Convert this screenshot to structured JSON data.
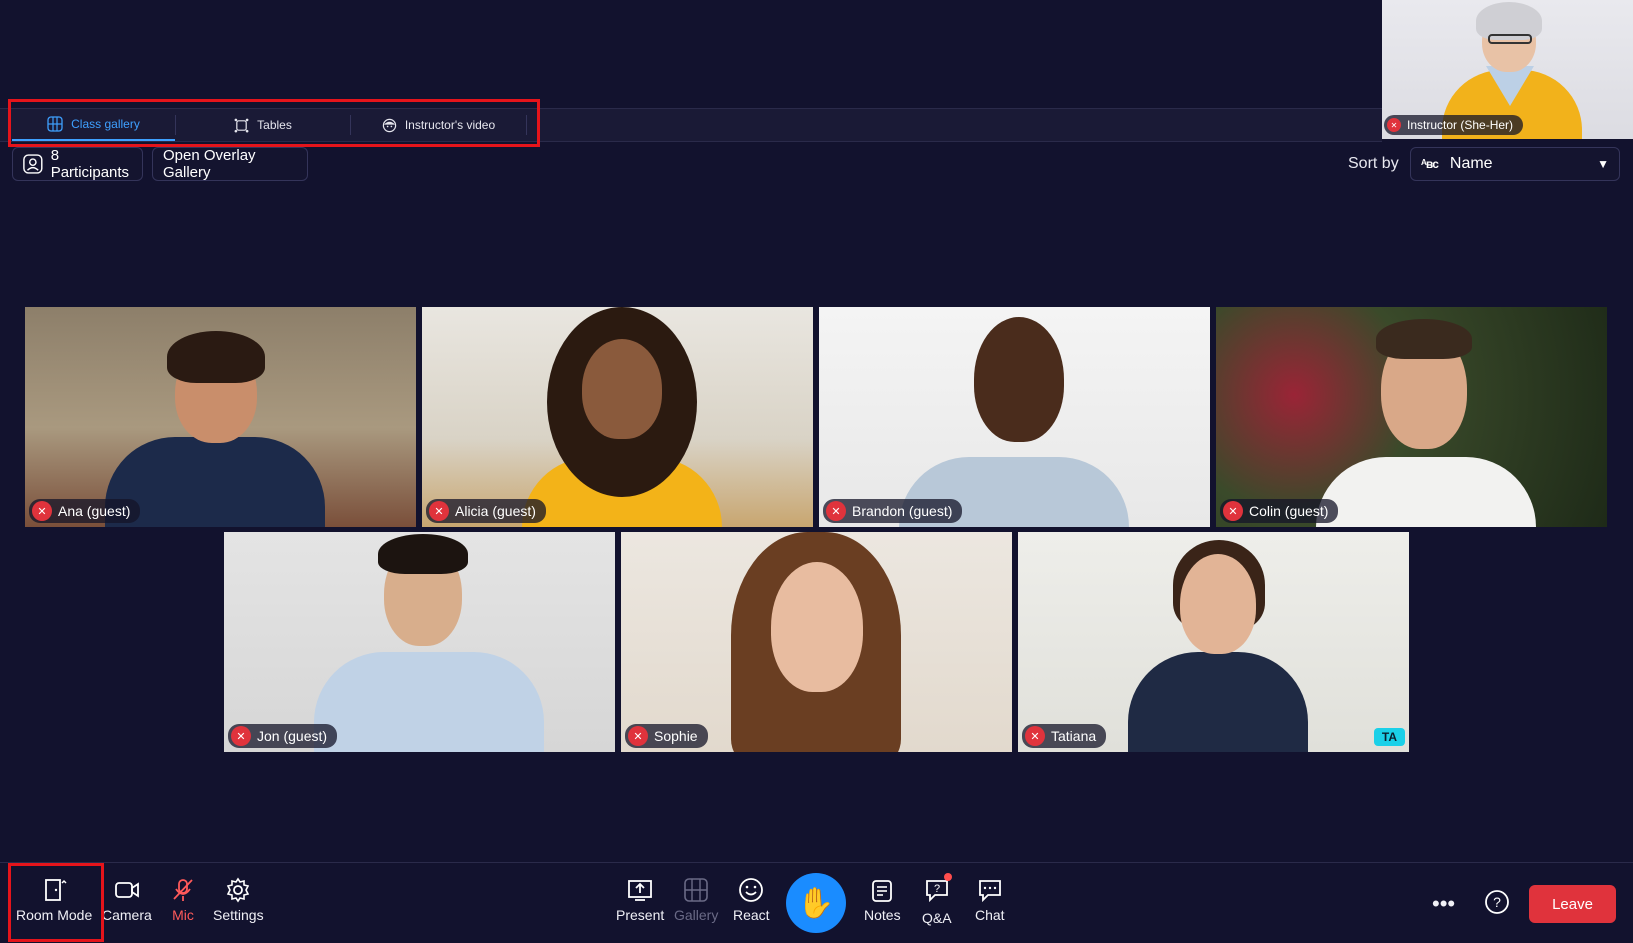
{
  "instructor": {
    "name": "Instructor (She-Her)",
    "mic_state": "muted"
  },
  "tabs": [
    {
      "label": "Class gallery",
      "icon": "grid-globe-icon",
      "active": true
    },
    {
      "label": "Tables",
      "icon": "tables-icon",
      "active": false
    },
    {
      "label": "Instructor's video",
      "icon": "face-icon",
      "active": false
    }
  ],
  "toolbar": {
    "participants_label": "8 Participants",
    "overlay_label": "Open Overlay Gallery",
    "sort_label": "Sort by",
    "sort_value": "Name"
  },
  "participants": [
    {
      "name": "Ana (guest)",
      "muted": true,
      "badge": ""
    },
    {
      "name": "Alicia (guest)",
      "muted": true,
      "badge": ""
    },
    {
      "name": "Brandon (guest)",
      "muted": true,
      "badge": ""
    },
    {
      "name": "Colin (guest)",
      "muted": true,
      "badge": ""
    },
    {
      "name": "Jon (guest)",
      "muted": true,
      "badge": ""
    },
    {
      "name": "Sophie",
      "muted": true,
      "badge": ""
    },
    {
      "name": "Tatiana",
      "muted": true,
      "badge": "TA"
    }
  ],
  "bottombar": {
    "room_mode": "Room Mode",
    "camera": "Camera",
    "mic": "Mic",
    "settings": "Settings",
    "present": "Present",
    "gallery": "Gallery",
    "react": "React",
    "notes": "Notes",
    "qa": "Q&A",
    "chat": "Chat",
    "leave": "Leave"
  },
  "colors": {
    "background": "#12122e",
    "accent": "#3ea0ff",
    "danger": "#e0333c",
    "highlight": "#e5141b"
  }
}
